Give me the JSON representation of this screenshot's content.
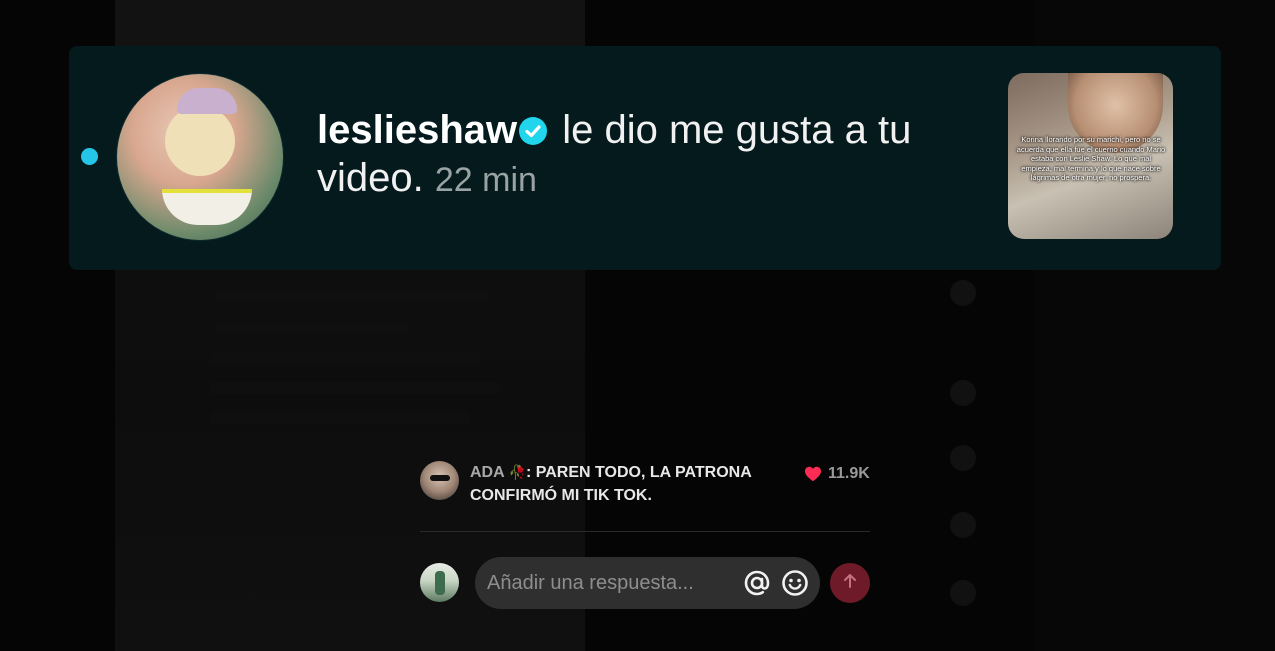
{
  "notification": {
    "username": "leslieshaw",
    "message": "le dio me gusta a tu video.",
    "time": "22 min",
    "thumbnail_caption": "Korina llorando por su marichi, pero no se acuerda que ella fue el cuerno cuando Mario estaba con Leslie Shaw. Lo que mal empieza, mal termina y lo que nace sobre lágrimas de otra mujer, no prospera.",
    "unread_dot_color": "#25c5e8",
    "verified_color": "#20d5ec"
  },
  "comment": {
    "author": "ADA",
    "author_emoji": "🥀",
    "separator": ":",
    "text": "PAREN TODO, LA PATRONA CONFIRMÓ MI TIK TOK.",
    "likes": "11.9K",
    "like_color": "#fe2c55"
  },
  "reply": {
    "placeholder": "Añadir una respuesta..."
  },
  "icons": {
    "mention": "at-icon",
    "emoji": "emoji-icon",
    "send": "arrow-up-icon",
    "like": "heart-icon",
    "verified": "verified-check-icon"
  }
}
